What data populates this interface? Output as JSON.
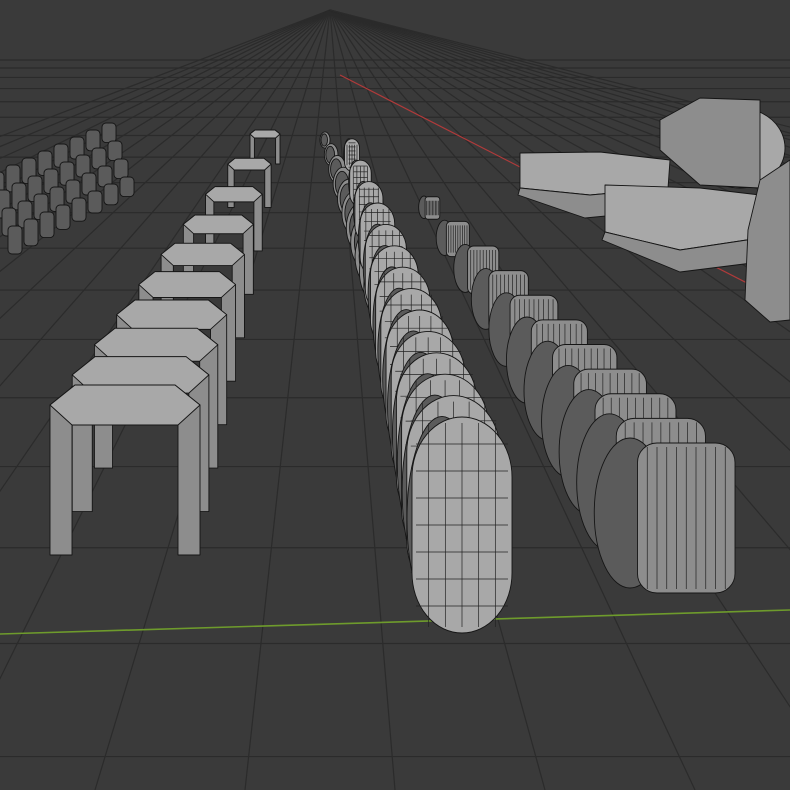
{
  "viewport": {
    "background": "#3a3a3a",
    "grid_color": "#2b2b2b",
    "x_axis_color": "#b03a3a",
    "y_axis_color": "#6e9b2c",
    "mesh_color": "#8d8d8d",
    "wire_color": "#151515"
  },
  "objects": {
    "arch_row_count": 10,
    "wheel_row_count": 14,
    "small_part_rows": 4,
    "machine_parts": [
      "crate",
      "crate",
      "engine-housing",
      "side-panel"
    ]
  }
}
